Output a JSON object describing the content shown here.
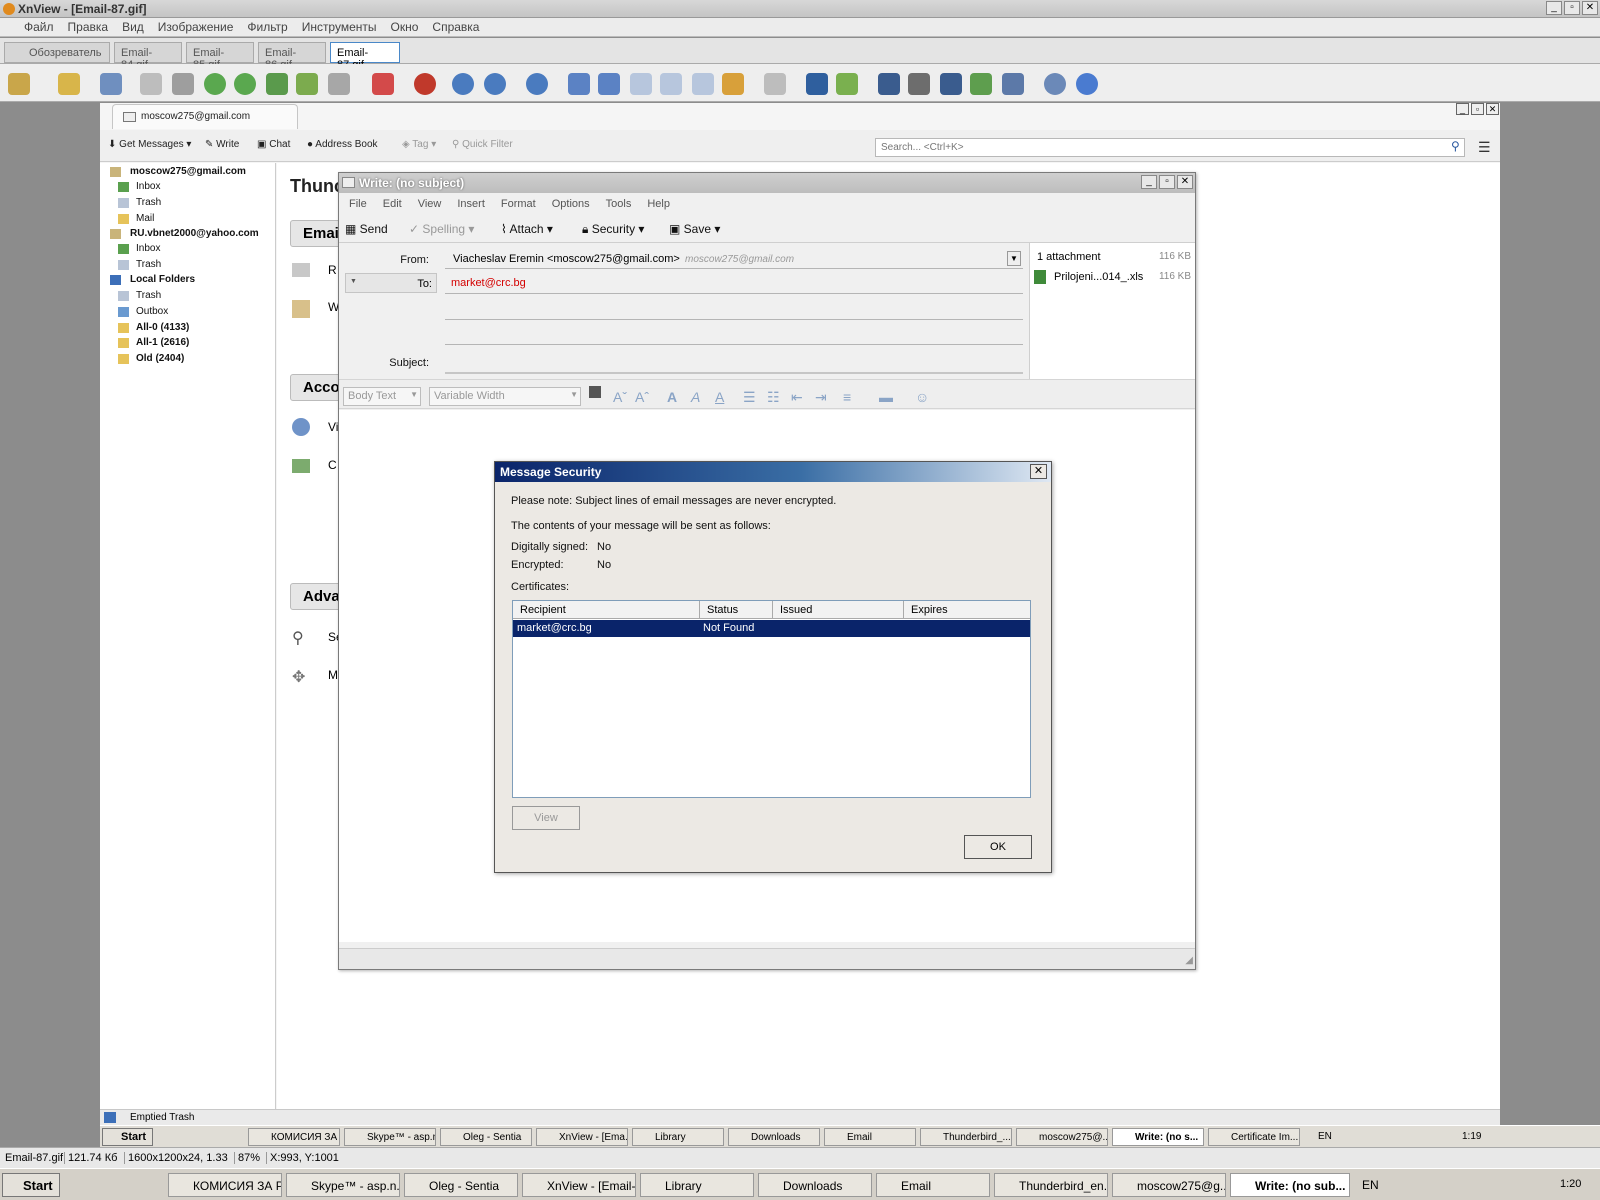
{
  "xnview": {
    "title": "XnView - [Email-87.gif]",
    "menu": [
      "Файл",
      "Правка",
      "Вид",
      "Изображение",
      "Фильтр",
      "Инструменты",
      "Окно",
      "Справка"
    ],
    "tabs": [
      "Обозреватель",
      "Email-84.gif",
      "Email-85.gif",
      "Email-86.gif",
      "Email-87.gif"
    ],
    "status": {
      "file": "Email-87.gif",
      "size": "121.74 Кб",
      "dims": "1600x1200x24, 1.33",
      "zoom": "87%",
      "coords": "X:993, Y:1001"
    }
  },
  "thunderbird": {
    "account_tab": "moscow275@gmail.com",
    "toolbar": {
      "get_messages": "Get Messages",
      "write": "Write",
      "chat": "Chat",
      "address_book": "Address Book",
      "tag": "Tag",
      "quick_filter": "Quick Filter"
    },
    "search_placeholder": "Search... <Ctrl+K>",
    "folders": [
      {
        "label": "moscow275@gmail.com",
        "bold": true
      },
      {
        "label": "Inbox"
      },
      {
        "label": "Trash"
      },
      {
        "label": "Mail"
      },
      {
        "label": "RU.vbnet2000@yahoo.com",
        "bold": true
      },
      {
        "label": "Inbox"
      },
      {
        "label": "Trash"
      },
      {
        "label": "Local Folders",
        "bold": true
      },
      {
        "label": "Trash"
      },
      {
        "label": "Outbox"
      },
      {
        "label": "All-0 (4133)",
        "bold": true
      },
      {
        "label": "All-1 (2616)",
        "bold": true
      },
      {
        "label": "Old (2404)",
        "bold": true
      }
    ],
    "main_heading": "Thunc",
    "section_buttons": [
      "Emai",
      "Acco",
      "Adva"
    ],
    "section_items": [
      "R",
      "W",
      "Vi",
      "C",
      "Se",
      "M"
    ],
    "status_text": "Emptied Trash"
  },
  "write": {
    "title": "Write: (no subject)",
    "menu": [
      "File",
      "Edit",
      "View",
      "Insert",
      "Format",
      "Options",
      "Tools",
      "Help"
    ],
    "toolbar": {
      "send": "Send",
      "spelling": "Spelling",
      "attach": "Attach",
      "security": "Security",
      "save": "Save"
    },
    "from_label": "From:",
    "from_value": "Viacheslav Eremin <moscow275@gmail.com>",
    "from_hint": "moscow275@gmail.com",
    "to_label": "To:",
    "to_value": "market@crc.bg",
    "subject_label": "Subject:",
    "attachments_header": "1 attachment",
    "attachments_total": "116 KB",
    "attachment_name": "Prilojeni...014_.xls",
    "attachment_size": "116 KB",
    "format": {
      "paragraph": "Body Text",
      "font": "Variable Width"
    }
  },
  "dialog": {
    "title": "Message Security",
    "note": "Please note: Subject lines of email messages are never encrypted.",
    "contents": "The contents of your message will be sent as follows:",
    "signed_label": "Digitally signed:",
    "signed_value": "No",
    "encrypted_label": "Encrypted:",
    "encrypted_value": "No",
    "certificates_label": "Certificates:",
    "columns": [
      "Recipient",
      "Status",
      "Issued",
      "Expires"
    ],
    "row": {
      "recipient": "market@crc.bg",
      "status": "Not Found",
      "issued": "",
      "expires": ""
    },
    "view_button": "View",
    "ok_button": "OK"
  },
  "taskbar_inner": {
    "start": "Start",
    "items": [
      "КОМИСИЯ ЗА Р...",
      "Skype™ - asp.n...",
      "Oleg - Sentia",
      "XnView - [Ema...",
      "Library",
      "Downloads",
      "Email",
      "Thunderbird_...",
      "moscow275@...",
      "Write: (no s...",
      "Certificate Im..."
    ],
    "lang": "EN",
    "clock": "1:19"
  },
  "taskbar_outer": {
    "start": "Start",
    "items": [
      "КОМИСИЯ ЗА Р...",
      "Skype™ - asp.n...",
      "Oleg - Sentia",
      "XnView - [Email-...",
      "Library",
      "Downloads",
      "Email",
      "Thunderbird_en...",
      "moscow275@g...",
      "Write: (no sub..."
    ],
    "lang": "EN",
    "clock": "1:20"
  },
  "colors": {
    "dialog_title": "#0a246a",
    "selected_row": "#0a246a",
    "to_value": "#d40000"
  }
}
